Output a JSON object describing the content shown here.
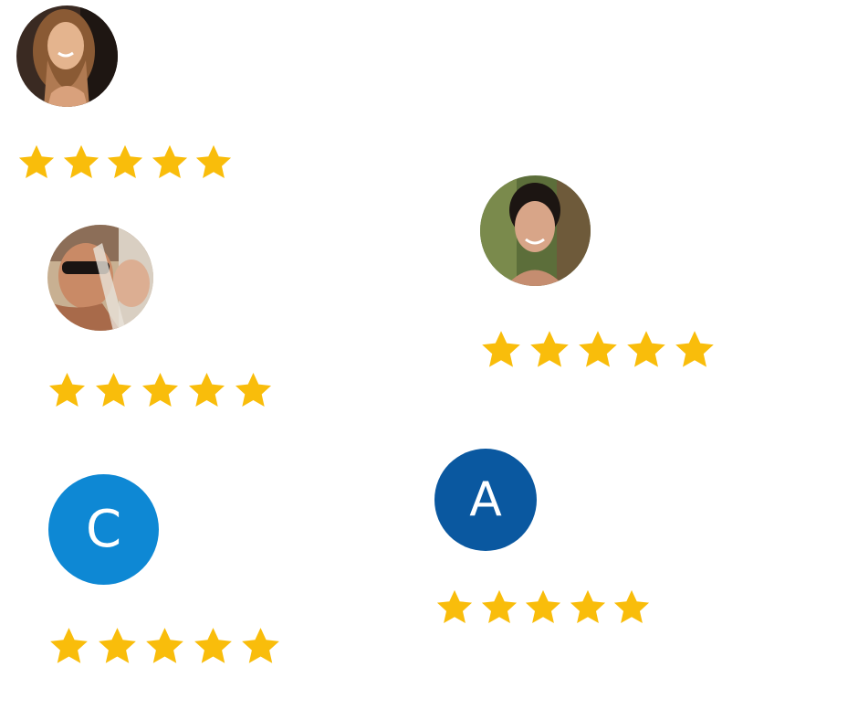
{
  "colors": {
    "star": "#f9bd0b",
    "avatar_c": "#0e88d4",
    "avatar_a": "#0a58a0"
  },
  "reviews": [
    {
      "avatar_type": "photo",
      "star_icon": "star-icon",
      "rating": 5,
      "max_rating": 5
    },
    {
      "avatar_type": "photo",
      "star_icon": "star-icon",
      "rating": 5,
      "max_rating": 5
    },
    {
      "avatar_type": "photo",
      "star_icon": "star-icon",
      "rating": 5,
      "max_rating": 5
    },
    {
      "avatar_type": "initial",
      "initial": "C",
      "star_icon": "star-icon",
      "rating": 5,
      "max_rating": 5
    },
    {
      "avatar_type": "initial",
      "initial": "A",
      "star_icon": "star-icon",
      "rating": 5,
      "max_rating": 5
    }
  ]
}
